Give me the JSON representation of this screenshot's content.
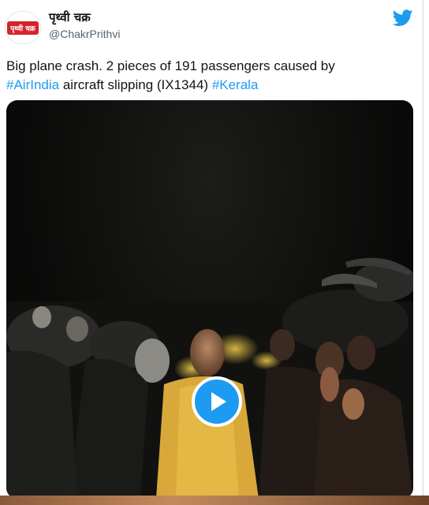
{
  "tweet": {
    "display_name": "पृथ्वी चक्र",
    "handle": "@ChakrPrithvi",
    "avatar_text": "पृथ्वी चक्र",
    "text_part1": "Big plane crash. 2 pieces of 191 passengers caused by",
    "hashtag1": "#AirIndia",
    "text_part2": " aircraft slipping (IX1344) ",
    "hashtag2": "#Kerala"
  },
  "media": {
    "type": "video",
    "play_icon": "play-icon"
  },
  "colors": {
    "hashtag": "#1d9bf0",
    "twitter_brand": "#1d9bf0",
    "avatar_badge": "#d4232a",
    "text": "#0f1419",
    "handle": "#536471"
  }
}
